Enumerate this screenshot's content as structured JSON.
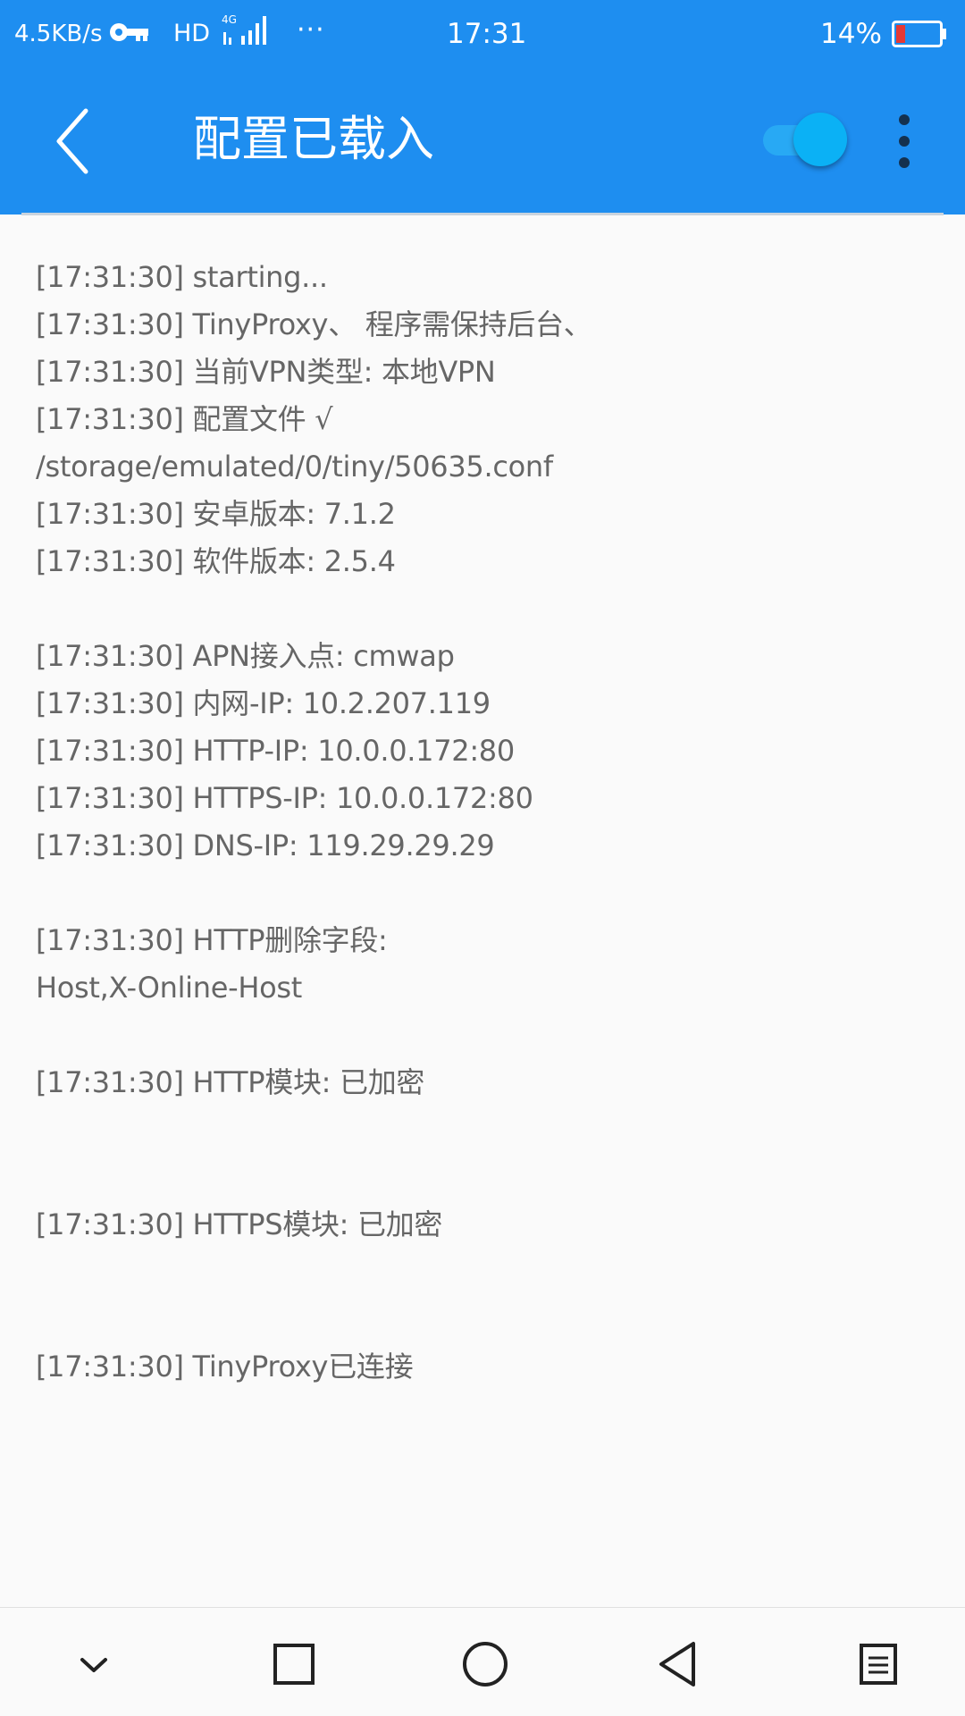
{
  "status_bar": {
    "speed": "4.5KB/s",
    "hd": "HD",
    "network": "4G",
    "more": "···",
    "time": "17:31",
    "battery_percent": "14%",
    "battery_level": 0.14,
    "battery_color": "#e53935"
  },
  "app_bar": {
    "title": "配置已载入",
    "toggle_on": true,
    "accent": "#1e8ef0"
  },
  "log": {
    "lines": [
      "[17:31:30] starting...",
      "[17:31:30] TinyProxy、 程序需保持后台、",
      "[17:31:30] 当前VPN类型: 本地VPN",
      "[17:31:30] 配置文件 √",
      "/storage/emulated/0/tiny/50635.conf",
      "[17:31:30] 安卓版本: 7.1.2",
      "[17:31:30] 软件版本: 2.5.4",
      "[17:31:30] APN接入点: cmwap",
      "[17:31:30] 内网-IP: 10.2.207.119",
      "[17:31:30] HTTP-IP: 10.0.0.172:80",
      "[17:31:30] HTTPS-IP: 10.0.0.172:80",
      "[17:31:30] DNS-IP: 119.29.29.29",
      "[17:31:30] HTTP删除字段:",
      "Host,X-Online-Host",
      "[17:31:30] HTTP模块: 已加密",
      "[17:31:30] HTTPS模块: 已加密",
      "[17:31:30] TinyProxy已连接"
    ]
  },
  "nav_bar": {
    "icons": [
      "chevron-down-icon",
      "square-icon",
      "circle-icon",
      "triangle-back-icon",
      "menu-icon"
    ]
  }
}
